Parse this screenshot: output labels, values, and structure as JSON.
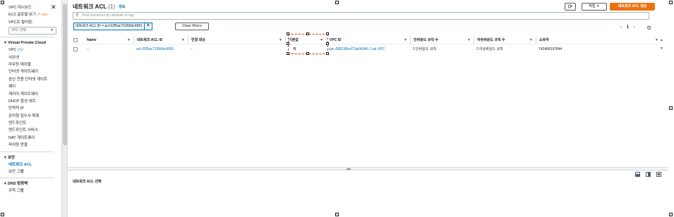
{
  "sidebar": {
    "top_items": [
      {
        "label": "VPC 대시보드"
      },
      {
        "label": "EC2 글로벌 보기",
        "badge": "New"
      }
    ],
    "filter_label": "VPC로 필터링:",
    "filter_value": "VPC 선택",
    "sections": [
      {
        "title": "Virtual Private Cloud",
        "items": [
          {
            "label": "VPC",
            "badge": "신규"
          },
          {
            "label": "서브넷"
          },
          {
            "label": "라우팅 테이블"
          },
          {
            "label": "인터넷 게이트웨이"
          },
          {
            "label": "송신 전용 인터넷 게이트"
          },
          {
            "label": "웨이"
          },
          {
            "label": "캐리어 게이트웨이"
          },
          {
            "label": "DHCP 옵션 세트"
          },
          {
            "label": "탄력적 IP"
          },
          {
            "label": "관리형 접두사 목록"
          },
          {
            "label": "엔드포인트"
          },
          {
            "label": "엔드포인트 서비스"
          },
          {
            "label": "NAT 게이트웨이"
          },
          {
            "label": "피어링 연결"
          }
        ]
      },
      {
        "title": "보안",
        "items": [
          {
            "label": "네트워크 ACL",
            "active": true
          },
          {
            "label": "보안 그룹"
          }
        ]
      },
      {
        "title": "DNS 방화벽",
        "items": [
          {
            "label": "규칙 그룹"
          }
        ]
      }
    ]
  },
  "header": {
    "title": "네트워크 ACL",
    "count": "(1)",
    "info": "정보",
    "refresh_icon": "refresh-icon",
    "actions_label": "작업",
    "create_label": "네트워크 ACL 생성"
  },
  "search": {
    "placeholder": "Find resources by attribute or tag"
  },
  "filter_chip": {
    "label": "네트워크 ACL ID = acl-02f5ac71560dc4581"
  },
  "clear_filters": "Clear filters",
  "pagination": {
    "prev": "‹",
    "page": "1",
    "next": "›"
  },
  "table": {
    "columns": [
      "Name",
      "네트워크 ACL ID",
      "연결 대상",
      "기본값",
      "VPC ID",
      "인바운드 규칙 수",
      "아웃바운드 규칙 수",
      "소유자"
    ],
    "rows": [
      {
        "name": "–",
        "acl_id": "acl-02f5ac71560dc4581",
        "associated": "–",
        "default": "예",
        "vpc_id": "vpc-086236bcf73a64049 / Lab VPC",
        "inbound": "2 인바운드 규칙",
        "outbound": "2 아웃바운드 규칙",
        "owner": "743468197844"
      }
    ]
  },
  "bottom_panel": {
    "label": "네트워크 ACL 선택"
  },
  "colors": {
    "accent": "#ec7211",
    "link": "#0073bb",
    "selection": "#d13212"
  }
}
